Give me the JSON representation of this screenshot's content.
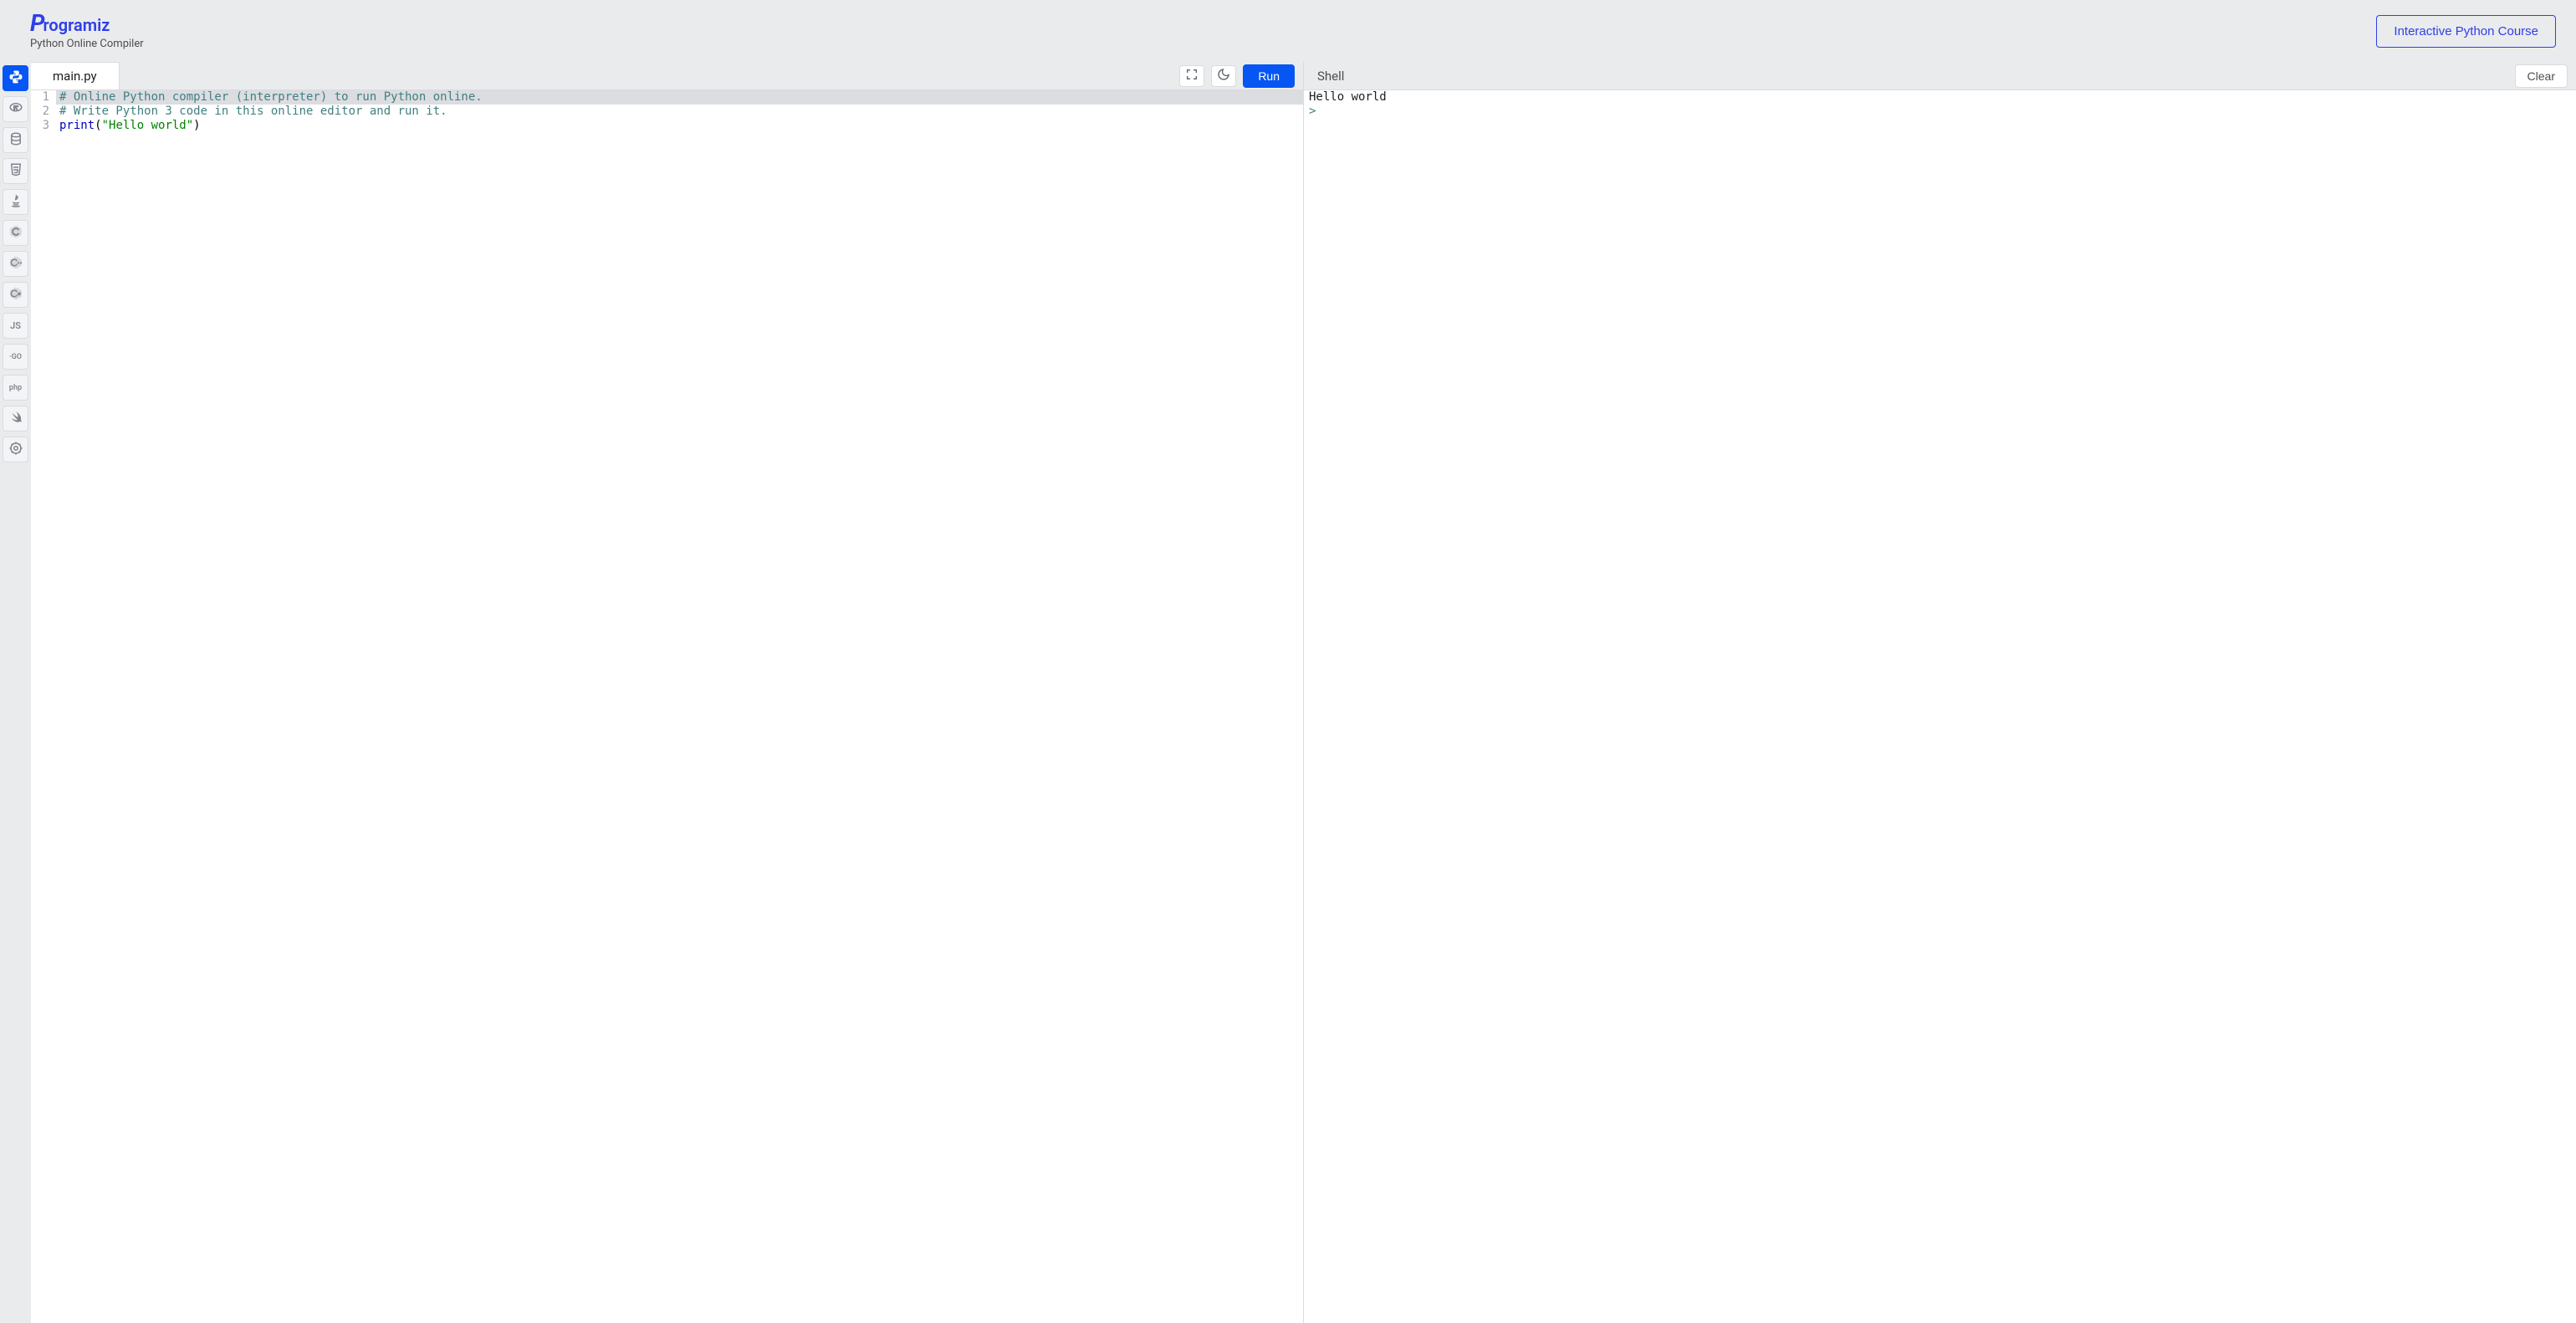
{
  "header": {
    "brand_prefix": "P",
    "brand_rest": "rogramiz",
    "subtitle": "Python Online Compiler",
    "course_button": "Interactive Python Course"
  },
  "sidebar": {
    "items": [
      {
        "name": "python",
        "kind": "svg",
        "active": true
      },
      {
        "name": "r",
        "kind": "svg",
        "active": false
      },
      {
        "name": "sql",
        "kind": "svg",
        "active": false
      },
      {
        "name": "html",
        "kind": "svg",
        "active": false
      },
      {
        "name": "java",
        "kind": "svg",
        "active": false
      },
      {
        "name": "c",
        "kind": "svg",
        "active": false
      },
      {
        "name": "cpp",
        "kind": "svg",
        "active": false
      },
      {
        "name": "csharp",
        "kind": "svg",
        "active": false
      },
      {
        "name": "js",
        "kind": "text",
        "label": "JS",
        "active": false
      },
      {
        "name": "go",
        "kind": "text",
        "label": "·GO",
        "active": false
      },
      {
        "name": "php",
        "kind": "text",
        "label": "php",
        "active": false
      },
      {
        "name": "swift",
        "kind": "svg",
        "active": false
      },
      {
        "name": "rust",
        "kind": "svg",
        "active": false
      }
    ]
  },
  "editor": {
    "file_tab": "main.py",
    "run_label": "Run",
    "lines": [
      {
        "n": "1",
        "cls": "current",
        "tokens": [
          {
            "t": "# Online Python compiler (interpreter) to run Python online.",
            "c": "tok-comment"
          }
        ]
      },
      {
        "n": "2",
        "cls": "",
        "tokens": [
          {
            "t": "# Write Python 3 code in this online editor and run it.",
            "c": "tok-comment"
          }
        ]
      },
      {
        "n": "3",
        "cls": "",
        "tokens": [
          {
            "t": "print",
            "c": "tok-func"
          },
          {
            "t": "(",
            "c": "tok-punc"
          },
          {
            "t": "\"Hello world\"",
            "c": "tok-str"
          },
          {
            "t": ")",
            "c": "tok-punc"
          }
        ]
      }
    ]
  },
  "shell": {
    "title": "Shell",
    "clear_label": "Clear",
    "output": "Hello world",
    "prompt": ">"
  }
}
